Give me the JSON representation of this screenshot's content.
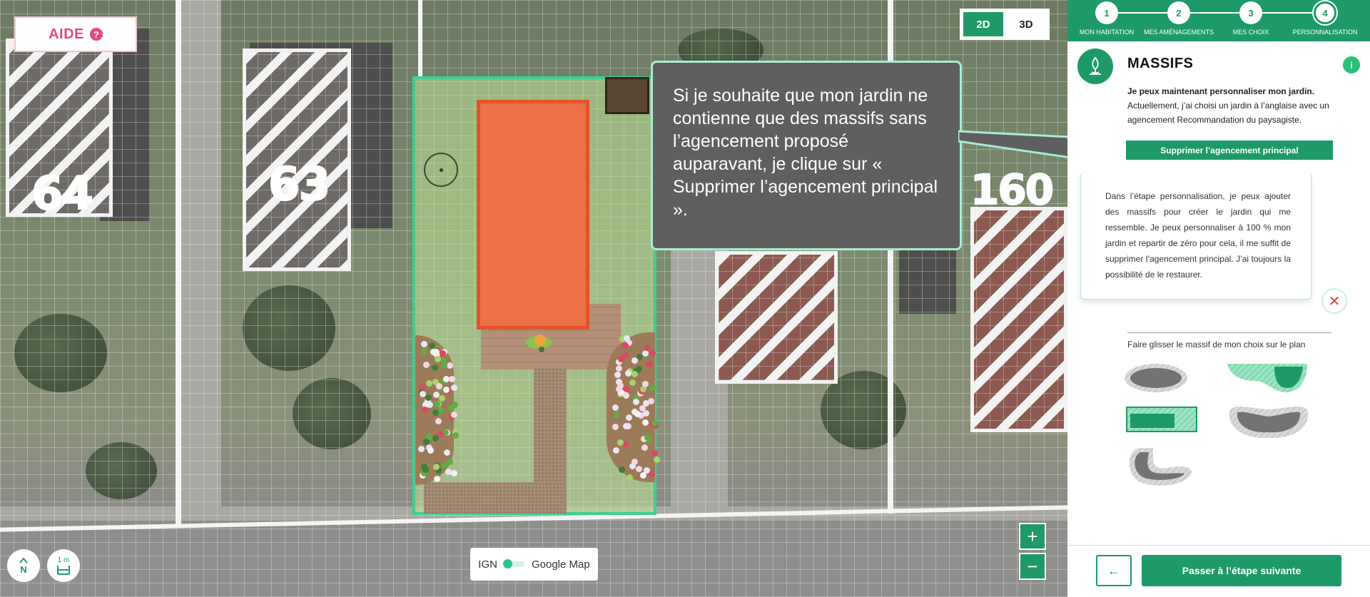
{
  "map": {
    "help_button": {
      "label": "AIDE",
      "icon": "question-icon",
      "icon_glyph": "?"
    },
    "view_toggle": {
      "options": [
        "2D",
        "3D"
      ],
      "active": "2D"
    },
    "house_numbers": [
      "64",
      "63",
      "160"
    ],
    "tooltip": {
      "text": "Si je souhaite que mon jardin ne contienne que des massifs sans l’agencement proposé auparavant, je clique sur « Supprimer l’agencement principal »."
    },
    "zoom": {
      "in": "+",
      "out": "−"
    },
    "layer_switch": {
      "left": "IGN",
      "right": "Google Map"
    },
    "north_button": {
      "label": "N",
      "icon": "north-arrow-icon"
    },
    "scale_button": {
      "label": "1 m",
      "icon": "scale-ruler-icon"
    },
    "colors": {
      "plot_border": "#3ecf8e",
      "pool": "#eb7147",
      "accent": "#1e9a68"
    }
  },
  "panel": {
    "stepper": {
      "steps": [
        {
          "number": "1",
          "label": "MON HABITATION"
        },
        {
          "number": "2",
          "label": "MES AMÉNAGEMENTS"
        },
        {
          "number": "3",
          "label": "MES CHOIX"
        },
        {
          "number": "4",
          "label": "PERSONNALISATION"
        }
      ],
      "current": "4"
    },
    "section": {
      "icon": "tree-icon",
      "title": "MASSIFS",
      "info_icon_glyph": "i",
      "intro_bold": "Je peux maintenant personnaliser mon jardin.",
      "intro_text": "Actuellement, j’ai choisi un jardin à l’anglaise avec un agencement Recommandation du paysagiste.",
      "remove_button": "Supprimer l’agencement principal"
    },
    "help_box": {
      "text": "Dans l’étape personnalisation, je peux ajouter des massifs pour créer le jardin qui me ressemble. Je peux personnaliser à 100 % mon jardin et repartir de zéro pour cela, il me suffit de supprimer l’agencement principal. J’ai toujours la possibilité de le restaurer.",
      "close_glyph": "✕"
    },
    "drag_label": "Faire glisser le massif de mon choix sur le plan",
    "massif_shapes": [
      "ellipse",
      "crescent",
      "rectangle",
      "kidney",
      "hook"
    ],
    "footer": {
      "back_glyph": "←",
      "next_label": "Passer à l’étape suivante"
    }
  }
}
